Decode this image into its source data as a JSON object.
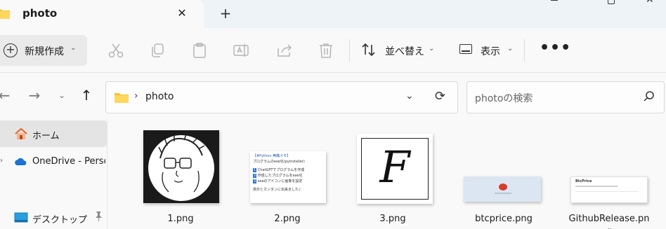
{
  "tab": {
    "title": "photo",
    "close": "✕",
    "new_tab": "+"
  },
  "window_controls": {
    "minimize": "minimize",
    "maximize": "maximize",
    "close": "✕"
  },
  "toolbar": {
    "new_label": "新規作成",
    "sort_label": "並べ替え",
    "view_label": "表示",
    "more": "•••",
    "chevron": "⌄"
  },
  "address_bar": {
    "separator": "›",
    "path": "photo",
    "dropdown": "⌄",
    "refresh": "⟳"
  },
  "search": {
    "placeholder": "photoの検索"
  },
  "nav_buttons": {
    "back": "←",
    "forward": "→",
    "recent": "⌄",
    "up": "↑"
  },
  "sidebar": {
    "items": [
      {
        "label": "ホーム",
        "icon": "home-icon",
        "selected": true
      },
      {
        "label": "OneDrive - Perso",
        "icon": "onedrive-icon",
        "expander": "›"
      },
      {
        "label": "デスクトップ",
        "icon": "desktop-icon",
        "pin": "📌"
      }
    ]
  },
  "files": [
    {
      "name": "1.png"
    },
    {
      "name": "2.png",
      "thumb_lines": [
        "【#Python 無職メモ】",
        "プログラムのexe化(pyinstaller)",
        "ChatGPTでプログラムを作成",
        "作成したプログラムをexe化",
        "exeのアイコンに画像を設定",
        "意外とカンタンに出来ました♪"
      ]
    },
    {
      "name": "3.png",
      "thumb_glyph": "F"
    },
    {
      "name": "btcprice.png"
    },
    {
      "name": "GithubRelease.pn\ng",
      "thumb_title": "BtcPrice"
    }
  ],
  "colors": {
    "folder": "#f4c430",
    "accent": "#0067c0",
    "onedrive": "#1a73d6"
  }
}
